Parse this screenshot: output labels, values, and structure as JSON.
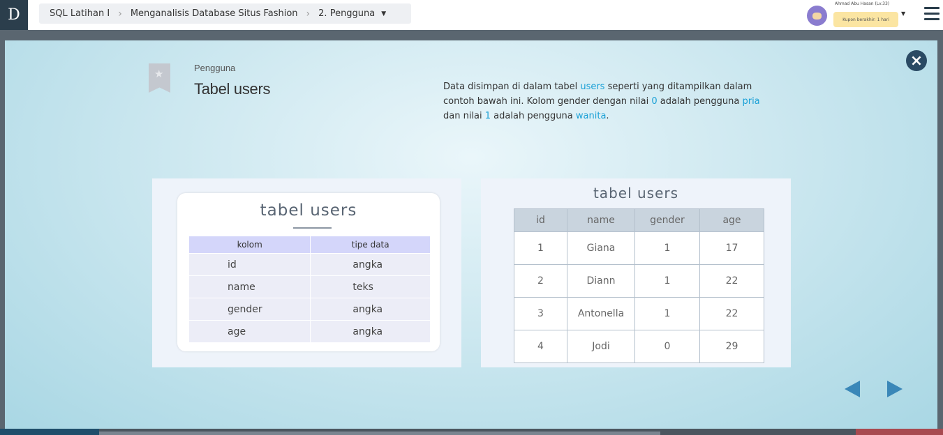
{
  "app": {
    "logo": "D"
  },
  "breadcrumb": {
    "course": "SQL Latihan I",
    "chapter": "Menganalisis Database Situs Fashion",
    "lesson": "2. Pengguna",
    "separator": "›",
    "caret": "▼"
  },
  "user": {
    "name": "Ahmad Abu Hasan (Lv.33)",
    "coupon": "Kupon berakhir: 1 hari",
    "caret": "▼"
  },
  "slide": {
    "subtitle": "Pengguna",
    "title": "Tabel users",
    "description": {
      "p1": "Data disimpan di dalam tabel ",
      "h1": "users",
      "p2": " seperti yang ditampilkan dalam contoh bawah ini. Kolom gender dengan nilai ",
      "h2": "0",
      "p3": " adalah pengguna ",
      "h3": "pria",
      "p4": " dan nilai ",
      "h4": "1",
      "p5": " adalah pengguna ",
      "h5": "wanita",
      "p6": "."
    },
    "close_icon": "×",
    "schema": {
      "title": "tabel users",
      "headers": [
        "kolom",
        "tipe data"
      ],
      "rows": [
        [
          "id",
          "angka"
        ],
        [
          "name",
          "teks"
        ],
        [
          "gender",
          "angka"
        ],
        [
          "age",
          "angka"
        ]
      ]
    },
    "data_table": {
      "title": "tabel users",
      "headers": [
        "id",
        "name",
        "gender",
        "age"
      ],
      "rows": [
        [
          "1",
          "Giana",
          "1",
          "17"
        ],
        [
          "2",
          "Diann",
          "1",
          "22"
        ],
        [
          "3",
          "Antonella",
          "1",
          "22"
        ],
        [
          "4",
          "Jodi",
          "0",
          "29"
        ]
      ]
    }
  },
  "colors": {
    "accent": "#1aa0d6",
    "nav_arrow": "#3a87b8",
    "header_dark": "#2b3e4c"
  }
}
